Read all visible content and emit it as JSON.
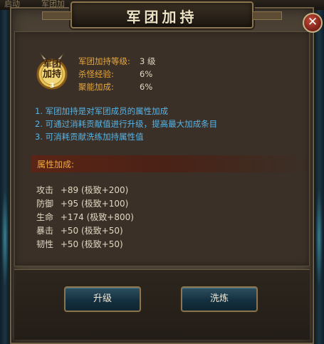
{
  "background": {
    "tab_left": "启动",
    "tab_right": "军团加"
  },
  "window": {
    "title": "军团加持"
  },
  "emblem": {
    "line1": "军团",
    "line2": "加持",
    "level_mark": "3"
  },
  "stats": [
    {
      "label": "军团加持等级:",
      "value": "3 级"
    },
    {
      "label": "杀怪经验:",
      "value": "6%"
    },
    {
      "label": "聚能加成:",
      "value": "6%"
    }
  ],
  "descriptions": [
    "1. 军团加持是对军团成员的属性加成",
    "2. 可通过消耗贡献值进行升级，提高最大加成条目",
    "3. 可消耗贡献洗练加持属性值"
  ],
  "attributes_header": "属性加成:",
  "attributes": [
    {
      "name": "攻击",
      "value": "+89 (极致+200)"
    },
    {
      "name": "防御",
      "value": "+95 (极致+100)"
    },
    {
      "name": "生命",
      "value": "+174 (极致+800)"
    },
    {
      "name": "暴击",
      "value": "+50 (极致+50)"
    },
    {
      "name": "韧性",
      "value": "+50 (极致+50)"
    }
  ],
  "buttons": {
    "upgrade": "升级",
    "refine": "洗炼"
  },
  "close_symbol": "✕",
  "colors": {
    "stat_label": "#e8a83e",
    "description": "#58b4e6",
    "attr_header": "#f0a840",
    "frame": "#8a7550"
  }
}
